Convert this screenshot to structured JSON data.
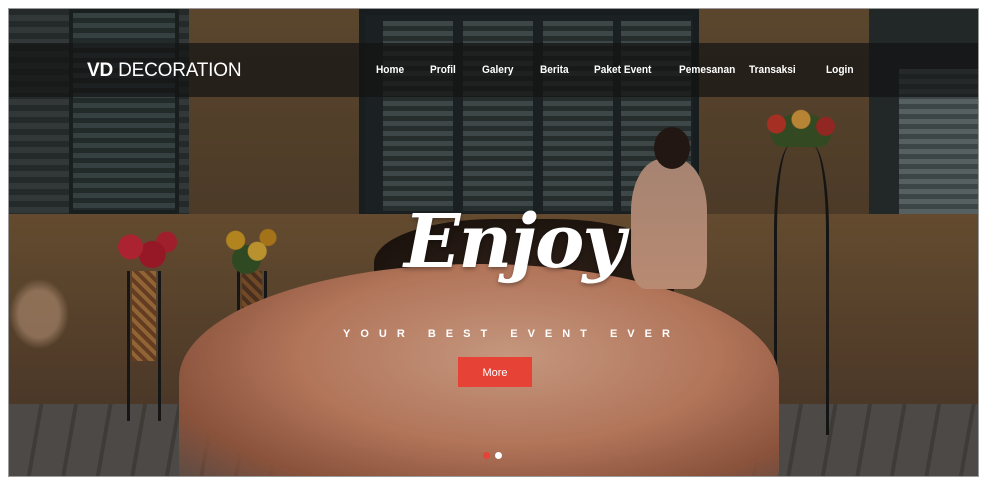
{
  "brand": {
    "bold": "VD",
    "light": "DECORATION"
  },
  "nav": {
    "items": [
      {
        "label": "Home"
      },
      {
        "label": "Profil"
      },
      {
        "label": "Galery"
      },
      {
        "label": "Berita"
      },
      {
        "label": "Paket Event"
      },
      {
        "label": "Pemesanan"
      },
      {
        "label": "Transaksi"
      },
      {
        "label": "Login"
      }
    ]
  },
  "hero": {
    "headline": "Enjoy",
    "tagline": "YOUR BEST EVENT EVER",
    "button_label": "More",
    "background_icon": "wedding-dress-photo",
    "slides_total": 2,
    "slide_active": 1
  },
  "colors": {
    "accent": "#e64235",
    "navbar": "#141414",
    "text": "#ffffff"
  }
}
